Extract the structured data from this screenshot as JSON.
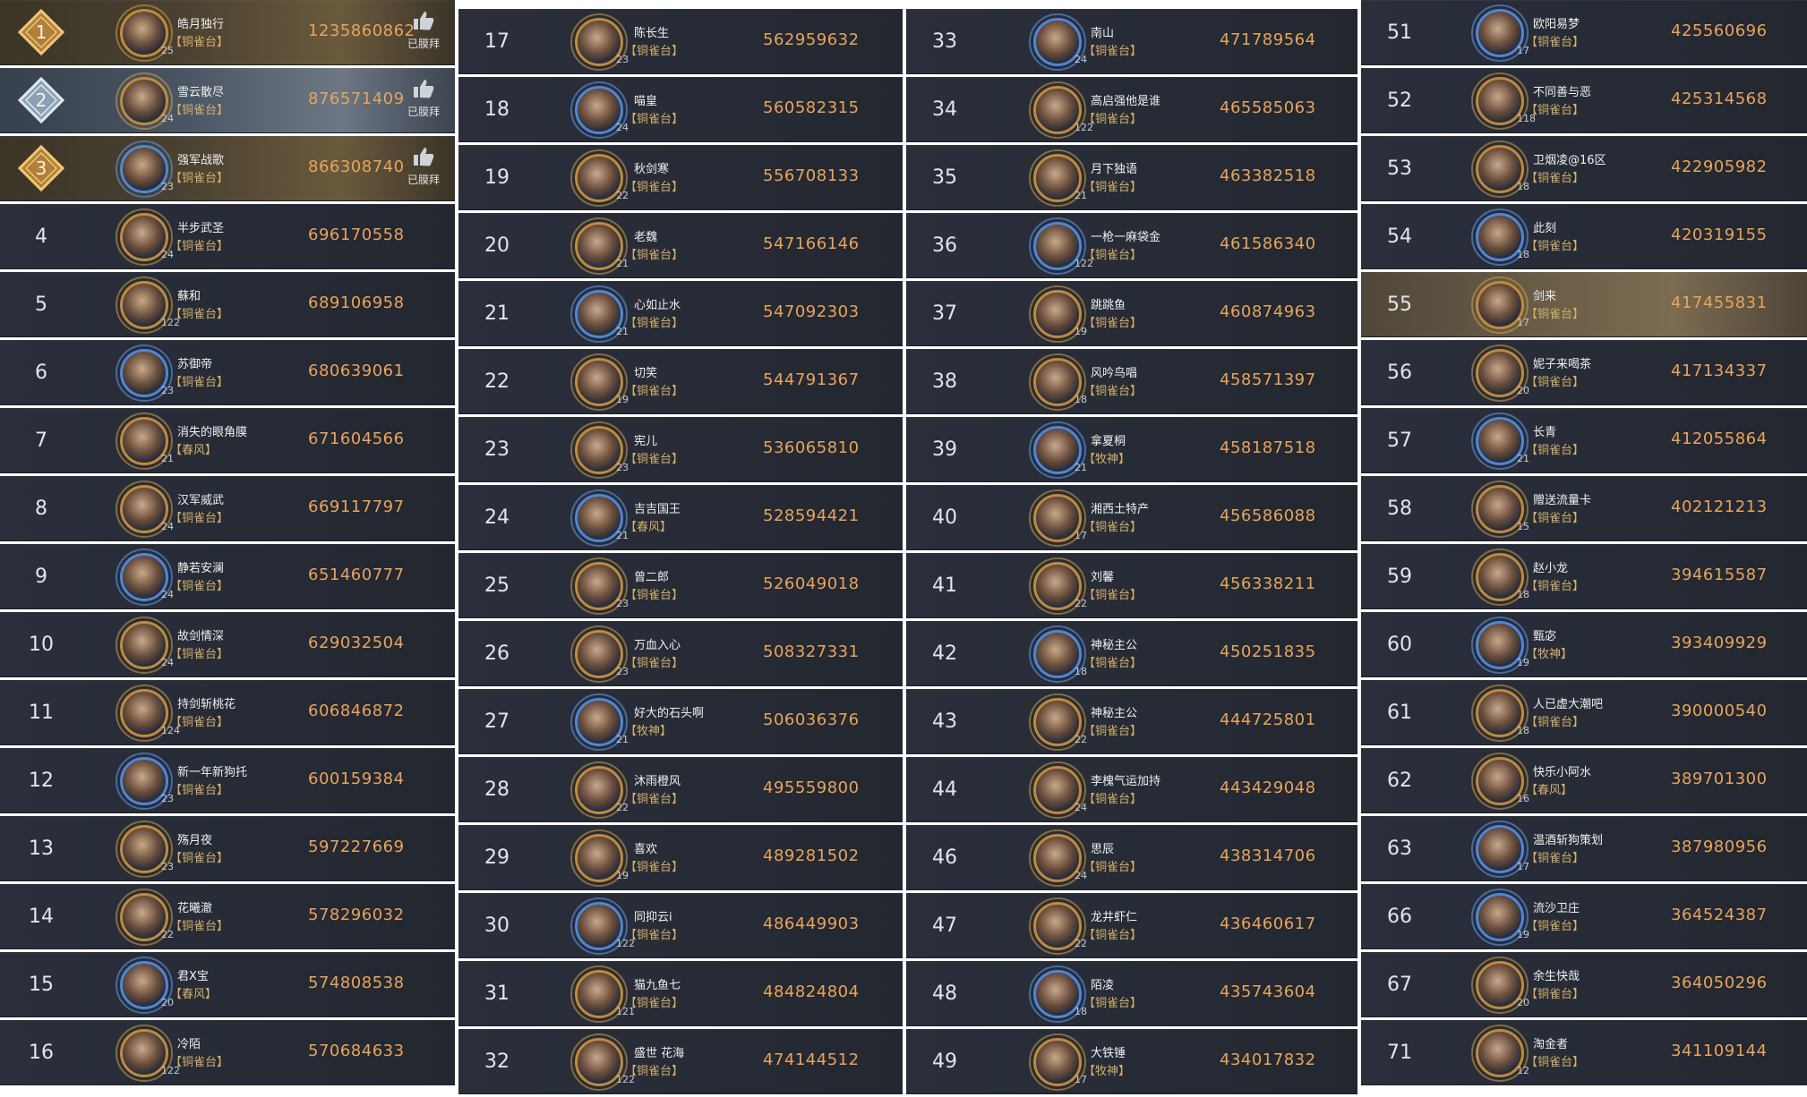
{
  "like_label": "已膜拜",
  "columns": [
    [
      {
        "rank": "1",
        "name": "皓月独行",
        "title": "【铜雀台】",
        "score": "1235860862",
        "level": "25",
        "liked": true
      },
      {
        "rank": "2",
        "name": "雪云散尽",
        "title": "【铜雀台】",
        "score": "876571409",
        "level": "24",
        "liked": true
      },
      {
        "rank": "3",
        "name": "强军战歌",
        "title": "【铜雀台】",
        "score": "866308740",
        "level": "23",
        "liked": true
      },
      {
        "rank": "4",
        "name": "半步武圣",
        "title": "【铜雀台】",
        "score": "696170558",
        "level": "24"
      },
      {
        "rank": "5",
        "name": "蘇和",
        "title": "【铜雀台】",
        "score": "689106958",
        "level": "122"
      },
      {
        "rank": "6",
        "name": "苏御帝",
        "title": "【铜雀台】",
        "score": "680639061",
        "level": "23"
      },
      {
        "rank": "7",
        "name": "消失的眼角膜",
        "title": "【春风】",
        "score": "671604566",
        "level": "21"
      },
      {
        "rank": "8",
        "name": "汉军威武",
        "title": "【铜雀台】",
        "score": "669117797",
        "level": "24"
      },
      {
        "rank": "9",
        "name": "静若安澜",
        "title": "【铜雀台】",
        "score": "651460777",
        "level": "24"
      },
      {
        "rank": "10",
        "name": "故剑情深",
        "title": "【铜雀台】",
        "score": "629032504",
        "level": "24"
      },
      {
        "rank": "11",
        "name": "持剑斩桃花",
        "title": "【铜雀台】",
        "score": "606846872",
        "level": "124"
      },
      {
        "rank": "12",
        "name": "新一年新狗托",
        "title": "【铜雀台】",
        "score": "600159384",
        "level": "23"
      },
      {
        "rank": "13",
        "name": "殇月夜",
        "title": "【铜雀台】",
        "score": "597227669",
        "level": "23"
      },
      {
        "rank": "14",
        "name": "花曦澈",
        "title": "【铜雀台】",
        "score": "578296032",
        "level": "22"
      },
      {
        "rank": "15",
        "name": "君X宝",
        "title": "【春风】",
        "score": "574808538",
        "level": "20"
      },
      {
        "rank": "16",
        "name": "冷陌",
        "title": "【铜雀台】",
        "score": "570684633",
        "level": "122"
      }
    ],
    [
      {
        "rank": "17",
        "name": "陈长生",
        "title": "【铜雀台】",
        "score": "562959632",
        "level": "23"
      },
      {
        "rank": "18",
        "name": "喵皇",
        "title": "【铜雀台】",
        "score": "560582315",
        "level": "24"
      },
      {
        "rank": "19",
        "name": "秋剑寒",
        "title": "【铜雀台】",
        "score": "556708133",
        "level": "22"
      },
      {
        "rank": "20",
        "name": "老魏",
        "title": "【铜雀台】",
        "score": "547166146",
        "level": "21"
      },
      {
        "rank": "21",
        "name": "心如止水",
        "title": "【铜雀台】",
        "score": "547092303",
        "level": "21"
      },
      {
        "rank": "22",
        "name": "切笑",
        "title": "【铜雀台】",
        "score": "544791367",
        "level": "19"
      },
      {
        "rank": "23",
        "name": "宪儿",
        "title": "【铜雀台】",
        "score": "536065810",
        "level": "23"
      },
      {
        "rank": "24",
        "name": "吉吉国王",
        "title": "【春风】",
        "score": "528594421",
        "level": "21"
      },
      {
        "rank": "25",
        "name": "曾二郎",
        "title": "【铜雀台】",
        "score": "526049018",
        "level": "23"
      },
      {
        "rank": "26",
        "name": "万血入心",
        "title": "【铜雀台】",
        "score": "508327331",
        "level": "23"
      },
      {
        "rank": "27",
        "name": "好大的石头啊",
        "title": "【牧神】",
        "score": "506036376",
        "level": "21"
      },
      {
        "rank": "28",
        "name": "沐雨橙风",
        "title": "【铜雀台】",
        "score": "495559800",
        "level": "22"
      },
      {
        "rank": "29",
        "name": "喜欢",
        "title": "【铜雀台】",
        "score": "489281502",
        "level": "19"
      },
      {
        "rank": "30",
        "name": "同抑云i",
        "title": "【铜雀台】",
        "score": "486449903",
        "level": "122"
      },
      {
        "rank": "31",
        "name": "猫九鱼七",
        "title": "【铜雀台】",
        "score": "484824804",
        "level": "121"
      },
      {
        "rank": "32",
        "name": "盛世 花海",
        "title": "【铜雀台】",
        "score": "474144512",
        "level": "122"
      }
    ],
    [
      {
        "rank": "33",
        "name": "南山",
        "title": "【铜雀台】",
        "score": "471789564",
        "level": "24"
      },
      {
        "rank": "34",
        "name": "高启强他是谁",
        "title": "【铜雀台】",
        "score": "465585063",
        "level": "122"
      },
      {
        "rank": "35",
        "name": "月下独语",
        "title": "【铜雀台】",
        "score": "463382518",
        "level": "21"
      },
      {
        "rank": "36",
        "name": "一枪一麻袋金",
        "title": "【铜雀台】",
        "score": "461586340",
        "level": "122"
      },
      {
        "rank": "37",
        "name": "跳跳鱼",
        "title": "【铜雀台】",
        "score": "460874963",
        "level": "19"
      },
      {
        "rank": "38",
        "name": "风吟鸟唱",
        "title": "【铜雀台】",
        "score": "458571397",
        "level": "18"
      },
      {
        "rank": "39",
        "name": "拿夏桐",
        "title": "【牧神】",
        "score": "458187518",
        "level": "21"
      },
      {
        "rank": "40",
        "name": "湘西土特产",
        "title": "【铜雀台】",
        "score": "456586088",
        "level": "17"
      },
      {
        "rank": "41",
        "name": "刘馨",
        "title": "【铜雀台】",
        "score": "456338211",
        "level": "22"
      },
      {
        "rank": "42",
        "name": "神秘主公",
        "title": "【铜雀台】",
        "score": "450251835",
        "level": "18"
      },
      {
        "rank": "43",
        "name": "神秘主公",
        "title": "【铜雀台】",
        "score": "444725801",
        "level": "22"
      },
      {
        "rank": "44",
        "name": "李槐气运加持",
        "title": "【铜雀台】",
        "score": "443429048",
        "level": "24"
      },
      {
        "rank": "46",
        "name": "思辰",
        "title": "【铜雀台】",
        "score": "438314706",
        "level": "24"
      },
      {
        "rank": "47",
        "name": "龙井虾仁",
        "title": "【铜雀台】",
        "score": "436460617",
        "level": "22"
      },
      {
        "rank": "48",
        "name": "陌凌",
        "title": "【铜雀台】",
        "score": "435743604",
        "level": "18"
      },
      {
        "rank": "49",
        "name": "大铁锤",
        "title": "【牧神】",
        "score": "434017832",
        "level": "17"
      }
    ],
    [
      {
        "rank": "51",
        "name": "欧阳易梦",
        "title": "【铜雀台】",
        "score": "425560696",
        "level": "17"
      },
      {
        "rank": "52",
        "name": "不同善与恶",
        "title": "【铜雀台】",
        "score": "425314568",
        "level": "118"
      },
      {
        "rank": "53",
        "name": "卫烟凌@16区",
        "title": "【铜雀台】",
        "score": "422905982",
        "level": "18"
      },
      {
        "rank": "54",
        "name": "此刻",
        "title": "【铜雀台】",
        "score": "420319155",
        "level": "18"
      },
      {
        "rank": "55",
        "name": "剑来",
        "title": "【铜雀台】",
        "score": "417455831",
        "level": "17",
        "self": true
      },
      {
        "rank": "56",
        "name": "妮子来喝茶",
        "title": "【铜雀台】",
        "score": "417134337",
        "level": "20"
      },
      {
        "rank": "57",
        "name": "长青",
        "title": "【铜雀台】",
        "score": "412055864",
        "level": "21"
      },
      {
        "rank": "58",
        "name": "赠送流量卡",
        "title": "【铜雀台】",
        "score": "402121213",
        "level": "15"
      },
      {
        "rank": "59",
        "name": "赵小龙",
        "title": "【铜雀台】",
        "score": "394615587",
        "level": "18"
      },
      {
        "rank": "60",
        "name": "甄宓",
        "title": "【牧神】",
        "score": "393409929",
        "level": "19"
      },
      {
        "rank": "61",
        "name": "人已虚大潮吧",
        "title": "【铜雀台】",
        "score": "390000540",
        "level": "18"
      },
      {
        "rank": "62",
        "name": "快乐小阿水",
        "title": "【春风】",
        "score": "389701300",
        "level": "16"
      },
      {
        "rank": "63",
        "name": "温酒斩狗策划",
        "title": "【铜雀台】",
        "score": "387980956",
        "level": "17"
      },
      {
        "rank": "66",
        "name": "流沙卫庄",
        "title": "【铜雀台】",
        "score": "364524387",
        "level": "19"
      },
      {
        "rank": "67",
        "name": "余生快哉",
        "title": "【铜雀台】",
        "score": "364050296",
        "level": "20"
      },
      {
        "rank": "71",
        "name": "淘金者",
        "title": "【铜雀台】",
        "score": "341109144",
        "level": "12"
      }
    ]
  ]
}
